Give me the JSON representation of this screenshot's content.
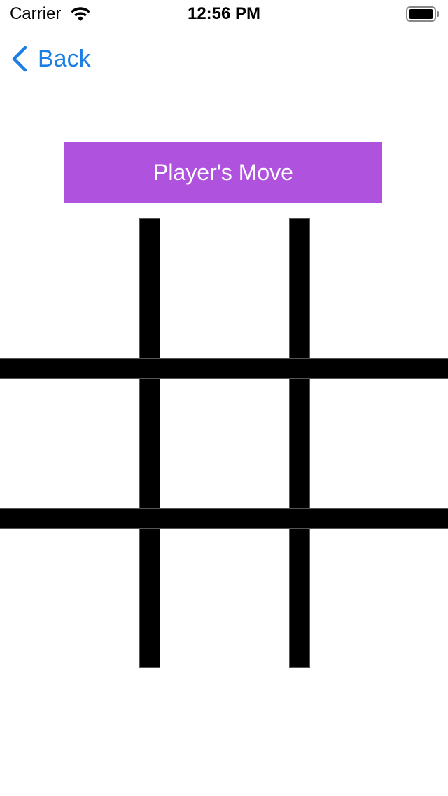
{
  "status_bar": {
    "carrier": "Carrier",
    "time": "12:56 PM",
    "wifi_icon": "wifi-icon",
    "battery_icon": "battery-full-icon"
  },
  "nav": {
    "back_label": "Back",
    "back_icon": "chevron-left-icon"
  },
  "turn_banner": {
    "label": "Player's Move",
    "color": "#af52de"
  },
  "board": {
    "rows": 3,
    "cols": 3,
    "cells": [
      "",
      "",
      "",
      "",
      "",
      "",
      "",
      "",
      ""
    ]
  },
  "colors": {
    "accent": "#1a7ee5",
    "grid": "#000000",
    "background": "#ffffff"
  }
}
